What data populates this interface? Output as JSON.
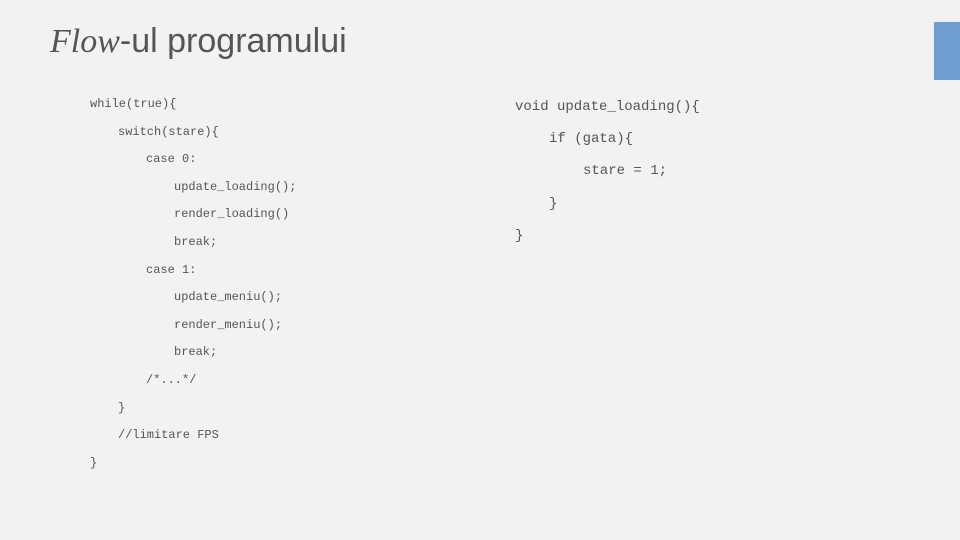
{
  "title_em": "Flow",
  "title_rest": "-ul programului",
  "left": {
    "l1": "while(true){",
    "l2": "switch(stare){",
    "l3": "case 0:",
    "l4": "update_loading();",
    "l5": "render_loading()",
    "l6": "break;",
    "l7": "case 1:",
    "l8": "update_meniu();",
    "l9": "render_meniu();",
    "l10": "break;",
    "l11": "/*...*/",
    "l12": "}",
    "l13": "//limitare FPS",
    "l14": "}"
  },
  "right": {
    "r1": "void update_loading(){",
    "r2": "if (gata){",
    "r3": "stare = 1;",
    "r4": "}",
    "r5": "}"
  }
}
